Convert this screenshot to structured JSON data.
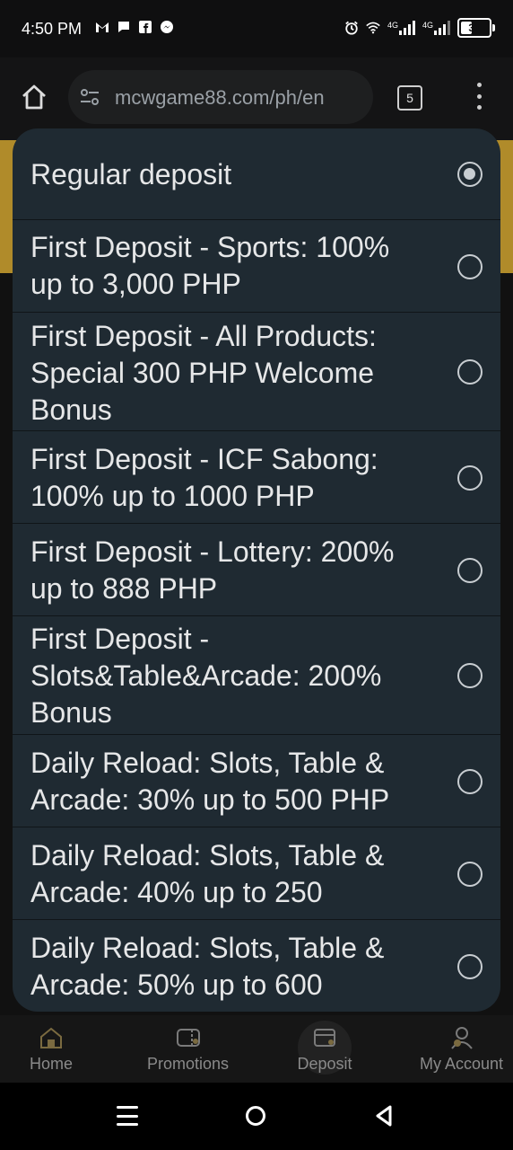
{
  "status_bar": {
    "time": "4:50 PM",
    "left_icons": [
      "gmail-icon",
      "messages-icon",
      "facebook-icon",
      "messenger-icon"
    ],
    "right_icons": [
      "alarm-icon",
      "wifi-icon",
      "signal-4g-icon",
      "signal-4g-icon"
    ],
    "signal_label_1": "4G",
    "signal_label_2": "4G",
    "battery": "31"
  },
  "browser": {
    "url": "mcwgame88.com/ph/en",
    "tab_count": "5"
  },
  "dropdown": {
    "selected_index": 0,
    "options": [
      "Regular deposit",
      "First Deposit - Sports: 100% up to 3,000 PHP",
      "First Deposit - All Products: Special 300 PHP Welcome Bonus",
      "First Deposit - ICF Sabong: 100% up to 1000 PHP",
      "First Deposit - Lottery: 200% up to 888 PHP",
      "First Deposit - Slots&Table&Arcade: 200% Bonus",
      "Daily Reload: Slots, Table & Arcade: 30% up to 500 PHP",
      "Daily Reload: Slots, Table & Arcade: 40% up to 250",
      "Daily Reload: Slots, Table & Arcade: 50% up to 600"
    ]
  },
  "bottom_nav": {
    "home": "Home",
    "promotions": "Promotions",
    "deposit": "Deposit",
    "my_account": "My Account"
  },
  "colors": {
    "dropdown_bg": "#1f2a32",
    "page_bg": "#0f0f10",
    "accent_gold": "#b08b2a"
  }
}
